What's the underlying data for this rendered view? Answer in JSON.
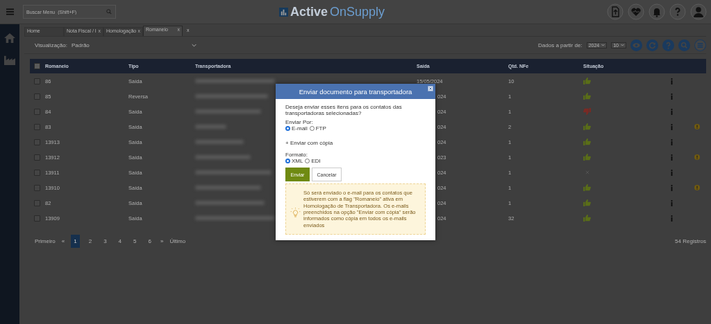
{
  "header": {
    "search_placeholder": "Buscar Menu  (Shift+F)",
    "logo_bold": "Active",
    "logo_light": "OnSupply"
  },
  "tabs": [
    {
      "label": "Home",
      "selected": false
    },
    {
      "label": "Nota Fiscal / I",
      "selected": false,
      "close": "x"
    },
    {
      "label": "Homologação",
      "selected": false,
      "close": "x"
    },
    {
      "label": "Romaneio",
      "selected": true,
      "close": "x"
    }
  ],
  "tabs_close_all": "x",
  "toolbar": {
    "view_label": "Visualização:",
    "view_value": "Padrão",
    "since_label": "Dados a partir de:",
    "year": "2024",
    "page_size": "10"
  },
  "table": {
    "select_all_checked": false,
    "columns": [
      "Romaneio",
      "Tipo",
      "Transportadora",
      "Saída",
      "Qtd. NFe",
      "Situação"
    ],
    "rows": [
      {
        "romaneio": "86",
        "tipo": "Saída",
        "saida": "15/05/2024",
        "qtd": "10",
        "kind": "approved",
        "warning": false,
        "checked": false
      },
      {
        "romaneio": "85",
        "tipo": "Reversa",
        "saida": "024",
        "qtd": "1",
        "kind": "approved",
        "warning": false,
        "checked": false
      },
      {
        "romaneio": "84",
        "tipo": "Saída",
        "saida": "024",
        "qtd": "1",
        "kind": "rejected",
        "warning": false,
        "checked": false
      },
      {
        "romaneio": "83",
        "tipo": "Saída",
        "saida": "024",
        "qtd": "2",
        "kind": "approved",
        "warning": true,
        "checked": false
      },
      {
        "romaneio": "13913",
        "tipo": "Saída",
        "saida": "024",
        "qtd": "1",
        "kind": "approved",
        "warning": false,
        "checked": false
      },
      {
        "romaneio": "13912",
        "tipo": "Saída",
        "saida": "023",
        "qtd": "1",
        "kind": "approved",
        "warning": true,
        "checked": false
      },
      {
        "romaneio": "13911",
        "tipo": "Saída",
        "saida": "024",
        "qtd": "1",
        "kind": "pending",
        "warning": false,
        "checked": false
      },
      {
        "romaneio": "13910",
        "tipo": "Saída",
        "saida": "024",
        "qtd": "1",
        "kind": "approved",
        "warning": true,
        "checked": false
      },
      {
        "romaneio": "82",
        "tipo": "Saída",
        "saida": "024",
        "qtd": "1",
        "kind": "approved",
        "warning": false,
        "checked": false
      },
      {
        "romaneio": "13909",
        "tipo": "Saída",
        "saida": "024",
        "qtd": "32",
        "kind": "approved",
        "warning": false,
        "checked": false
      }
    ]
  },
  "pagination": {
    "first": "Primeiro",
    "prev": "«",
    "pages": [
      {
        "label": "1",
        "selected": true
      },
      {
        "label": "2",
        "selected": false
      },
      {
        "label": "3",
        "selected": false
      },
      {
        "label": "4",
        "selected": false
      },
      {
        "label": "5",
        "selected": false
      },
      {
        "label": "6",
        "selected": false
      }
    ],
    "next": "»",
    "last": "Último",
    "total": "54 Registros"
  },
  "dialog": {
    "title": "Enviar documento para transportadora",
    "question": "Deseja enviar esses itens para os contatos das transportadoras selecionadas?",
    "send_by_label": "Enviar Por:",
    "send_by": [
      {
        "label": "E-mail",
        "selected": true
      },
      {
        "label": "FTP",
        "selected": false
      }
    ],
    "cc_link": "+ Enviar com cópia",
    "format_label": "Formato:",
    "formats": [
      {
        "label": "XML",
        "selected": true
      },
      {
        "label": "EDI",
        "selected": false
      }
    ],
    "primary_button": "Enviar",
    "secondary_button": "Cancelar",
    "notice": "Só será enviado o e-mail para os contatos que estiverem com a flag \"Romaneio\" ativa em Homologação de Transportadora. Os e-mails preenchidos na opção \"Enviar com cópia\" serão informados como cópia em todos os e-mails enviados"
  }
}
